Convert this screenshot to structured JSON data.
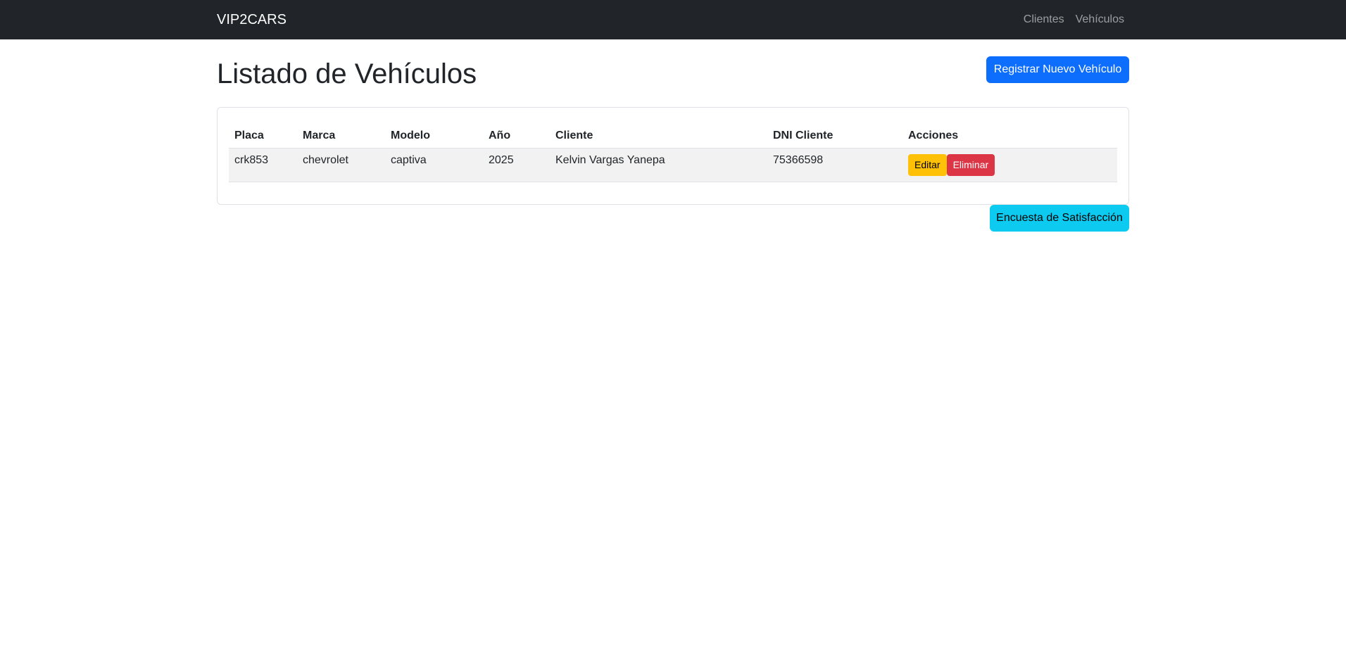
{
  "navbar": {
    "brand": "VIP2CARS",
    "links": [
      "Clientes",
      "Vehículos"
    ]
  },
  "page": {
    "title": "Listado de Vehículos",
    "new_button": "Registrar Nuevo Vehículo",
    "survey_button": "Encuesta de Satisfacción"
  },
  "table": {
    "headers": [
      "Placa",
      "Marca",
      "Modelo",
      "Año",
      "Cliente",
      "DNI Cliente",
      "Acciones"
    ],
    "rows": [
      {
        "placa": "crk853",
        "marca": "chevrolet",
        "modelo": "captiva",
        "anio": "2025",
        "cliente": "Kelvin Vargas Yanepa",
        "dni": "75366598",
        "edit_label": "Editar",
        "delete_label": "Eliminar"
      }
    ]
  },
  "colors": {
    "navbar": "#212529",
    "primary": "#0d6efd",
    "info": "#0dcaf0",
    "warning": "#ffc107",
    "danger": "#dc3545"
  }
}
